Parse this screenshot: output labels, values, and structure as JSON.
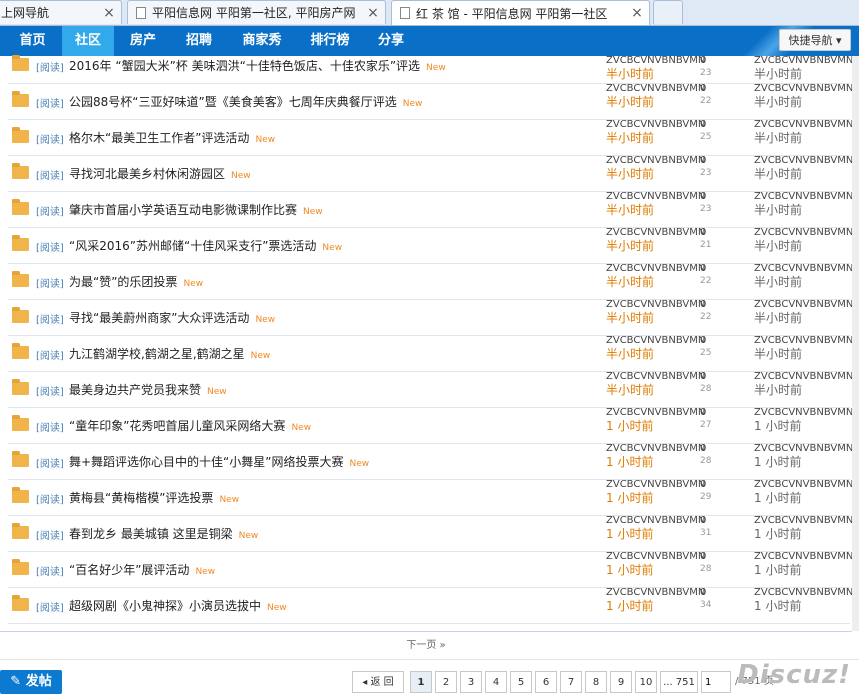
{
  "tabs": [
    {
      "title": "上网导航"
    },
    {
      "title": "平阳信息网 平阳第一社区, 平阳房产网"
    },
    {
      "title": "红 茶 馆 - 平阳信息网 平阳第一社区"
    }
  ],
  "close_glyph": "×",
  "nav": {
    "items": [
      "首页",
      "社区",
      "房产",
      "招聘",
      "商家秀",
      "排行榜",
      "分享"
    ],
    "active": "社区",
    "quick_label": "快捷导航 ▾"
  },
  "threads": [
    {
      "tag": "[阅读]",
      "title": "2016年 “蟹园大米”杯 美味泗洪“十佳特色饭店、十佳农家乐”评选",
      "new": "New",
      "author": "ZVCBCVNVBNBVMN",
      "time": "半小时前",
      "replies": "0",
      "views": "23",
      "last_author": "ZVCBCVNVBNBVMN",
      "last_time": "半小时前"
    },
    {
      "tag": "[阅读]",
      "title": "公园88号杯“三亚好味道”暨《美食美客》七周年庆典餐厅评选",
      "new": "New",
      "author": "ZVCBCVNVBNBVMN",
      "time": "半小时前",
      "replies": "0",
      "views": "22",
      "last_author": "ZVCBCVNVBNBVMN",
      "last_time": "半小时前"
    },
    {
      "tag": "[阅读]",
      "title": "格尔木“最美卫生工作者”评选活动",
      "new": "New",
      "author": "ZVCBCVNVBNBVMN",
      "time": "半小时前",
      "replies": "0",
      "views": "25",
      "last_author": "ZVCBCVNVBNBVMN",
      "last_time": "半小时前"
    },
    {
      "tag": "[阅读]",
      "title": "寻找河北最美乡村休闲游园区",
      "new": "New",
      "author": "ZVCBCVNVBNBVMN",
      "time": "半小时前",
      "replies": "0",
      "views": "23",
      "last_author": "ZVCBCVNVBNBVMN",
      "last_time": "半小时前"
    },
    {
      "tag": "[阅读]",
      "title": "肇庆市首届小学英语互动电影微课制作比赛",
      "new": "New",
      "author": "ZVCBCVNVBNBVMN",
      "time": "半小时前",
      "replies": "0",
      "views": "23",
      "last_author": "ZVCBCVNVBNBVMN",
      "last_time": "半小时前"
    },
    {
      "tag": "[阅读]",
      "title": "“风采2016”苏州邮储“十佳风采支行”票选活动",
      "new": "New",
      "author": "ZVCBCVNVBNBVMN",
      "time": "半小时前",
      "replies": "0",
      "views": "21",
      "last_author": "ZVCBCVNVBNBVMN",
      "last_time": "半小时前"
    },
    {
      "tag": "[阅读]",
      "title": "为最“赞”的乐团投票",
      "new": "New",
      "author": "ZVCBCVNVBNBVMN",
      "time": "半小时前",
      "replies": "0",
      "views": "22",
      "last_author": "ZVCBCVNVBNBVMN",
      "last_time": "半小时前"
    },
    {
      "tag": "[阅读]",
      "title": "寻找“最美蔚州商家”大众评选活动",
      "new": "New",
      "author": "ZVCBCVNVBNBVMN",
      "time": "半小时前",
      "replies": "0",
      "views": "22",
      "last_author": "ZVCBCVNVBNBVMN",
      "last_time": "半小时前"
    },
    {
      "tag": "[阅读]",
      "title": "九江鹤湖学校,鹤湖之星,鹤湖之星",
      "new": "New",
      "author": "ZVCBCVNVBNBVMN",
      "time": "半小时前",
      "replies": "0",
      "views": "25",
      "last_author": "ZVCBCVNVBNBVMN",
      "last_time": "半小时前"
    },
    {
      "tag": "[阅读]",
      "title": "最美身边共产党员我来赞",
      "new": "New",
      "author": "ZVCBCVNVBNBVMN",
      "time": "半小时前",
      "replies": "0",
      "views": "28",
      "last_author": "ZVCBCVNVBNBVMN",
      "last_time": "半小时前"
    },
    {
      "tag": "[阅读]",
      "title": "“童年印象”花秀吧首届儿童风采网络大赛",
      "new": "New",
      "author": "ZVCBCVNVBNBVMN",
      "time": "1 小时前",
      "replies": "0",
      "views": "27",
      "last_author": "ZVCBCVNVBNBVMN",
      "last_time": "1 小时前"
    },
    {
      "tag": "[阅读]",
      "title": "舞+舞蹈评选你心目中的十佳“小舞星”网络投票大赛",
      "new": "New",
      "author": "ZVCBCVNVBNBVMN",
      "time": "1 小时前",
      "replies": "0",
      "views": "28",
      "last_author": "ZVCBCVNVBNBVMN",
      "last_time": "1 小时前"
    },
    {
      "tag": "[阅读]",
      "title": "黄梅县“黄梅楷模”评选投票",
      "new": "New",
      "author": "ZVCBCVNVBNBVMN",
      "time": "1 小时前",
      "replies": "0",
      "views": "29",
      "last_author": "ZVCBCVNVBNBVMN",
      "last_time": "1 小时前"
    },
    {
      "tag": "[阅读]",
      "title": "春到龙乡 最美城镇 这里是铜梁",
      "new": "New",
      "author": "ZVCBCVNVBNBVMN",
      "time": "1 小时前",
      "replies": "0",
      "views": "31",
      "last_author": "ZVCBCVNVBNBVMN",
      "last_time": "1 小时前"
    },
    {
      "tag": "[阅读]",
      "title": "“百名好少年”展评活动",
      "new": "New",
      "author": "ZVCBCVNVBNBVMN",
      "time": "1 小时前",
      "replies": "0",
      "views": "28",
      "last_author": "ZVCBCVNVBNBVMN",
      "last_time": "1 小时前"
    },
    {
      "tag": "[阅读]",
      "title": "超级网剧《小鬼神探》小演员选拔中",
      "new": "New",
      "author": "ZVCBCVNVBNBVMN",
      "time": "1 小时前",
      "replies": "0",
      "views": "34",
      "last_author": "ZVCBCVNVBNBVMN",
      "last_time": "1 小时前"
    }
  ],
  "next_page": "下一页 »",
  "post_button": "发帖",
  "pager": {
    "prev": "◂ 返 回",
    "pages": [
      "1",
      "2",
      "3",
      "4",
      "5",
      "6",
      "7",
      "8",
      "9",
      "10",
      "... 751"
    ],
    "current": "1",
    "goto_value": "1",
    "total": "/ 751 页"
  },
  "brand": "Discuz!"
}
